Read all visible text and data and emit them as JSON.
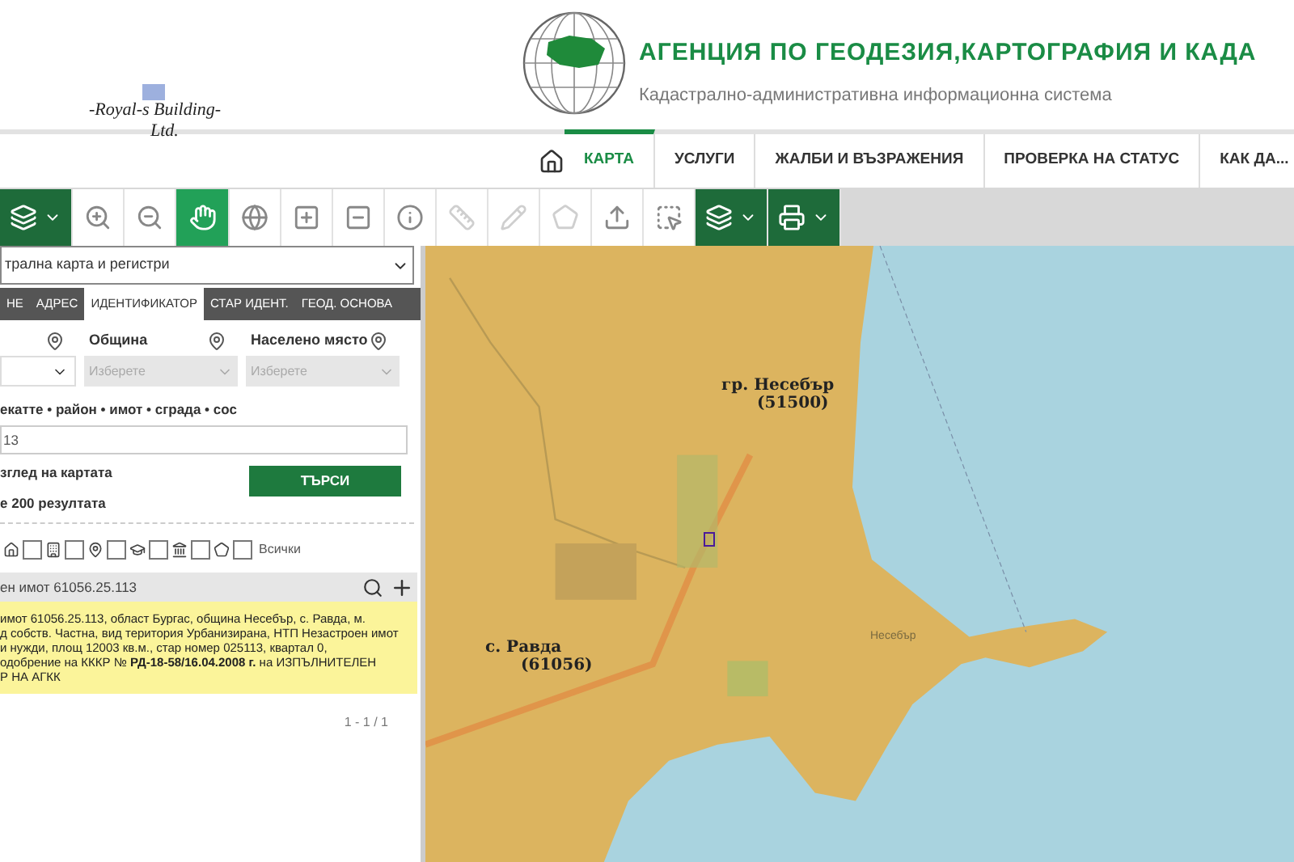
{
  "header": {
    "agency": "АГЕНЦИЯ ПО ГЕОДЕЗИЯ,КАРТОГРАФИЯ И КАДА",
    "subtitle": "Кадастрално-административна информационна система",
    "company_line_1": "-Royal-s Building-",
    "company_line_2": "Ltd."
  },
  "nav": [
    {
      "label": "КАРТА",
      "selected": true
    },
    {
      "label": "УСЛУГИ",
      "selected": false
    },
    {
      "label": "ЖАЛБИ И ВЪЗРАЖЕНИЯ",
      "selected": false
    },
    {
      "label": "ПРОВЕРКА НА СТАТУС",
      "selected": false
    },
    {
      "label": "КАК ДА...",
      "selected": false
    }
  ],
  "toolbar": [
    {
      "kind": "menu"
    },
    {
      "kind": "tool",
      "selected": false,
      "disabled": false
    },
    {
      "kind": "tool",
      "selected": false,
      "disabled": false
    },
    {
      "kind": "tool",
      "selected": true,
      "disabled": false
    },
    {
      "kind": "tool",
      "selected": false,
      "disabled": false
    },
    {
      "kind": "tool",
      "selected": false,
      "disabled": false
    },
    {
      "kind": "tool",
      "selected": false,
      "disabled": false
    },
    {
      "kind": "tool",
      "selected": false,
      "disabled": false
    },
    {
      "kind": "tool",
      "selected": false,
      "disabled": true
    },
    {
      "kind": "tool",
      "selected": false,
      "disabled": true
    },
    {
      "kind": "tool",
      "selected": false,
      "disabled": true
    },
    {
      "kind": "tool",
      "selected": false,
      "disabled": false
    },
    {
      "kind": "tool",
      "selected": false,
      "disabled": false
    },
    {
      "kind": "menu"
    },
    {
      "kind": "menu"
    }
  ],
  "panel": {
    "source_select": "трална карта и регистри",
    "tabs": [
      {
        "label": "НЕ",
        "selected": false
      },
      {
        "label": "АДРЕС",
        "selected": false
      },
      {
        "label": "ИДЕНТИФИКАТОР",
        "selected": true
      },
      {
        "label": "СТАР ИДЕНТ.",
        "selected": false
      },
      {
        "label": "ГЕОД. ОСНОВА",
        "selected": false
      }
    ],
    "fields": [
      {
        "label": "Община",
        "placeholder": "Изберете"
      },
      {
        "label": "Населено място",
        "placeholder": "Изберете"
      }
    ],
    "identifier_label": "екатте • район • имот • сграда • сос",
    "identifier_value": "13",
    "option_1": "зглед на картата",
    "option_2": "е 200 резултата",
    "search_button": "ТЪРСИ",
    "filters": [
      {
        "checked": false
      },
      {
        "checked": false
      },
      {
        "checked": false
      },
      {
        "checked": false
      },
      {
        "checked": false
      },
      {
        "checked": false
      }
    ],
    "all_label": "Всички",
    "result_title": "ен имот 61056.25.113",
    "result_lines": [
      "имот 61056.25.113, област Бургас, община Несебър, с. Равда, м.",
      "д собств. Частна, вид територия Урбанизирана, НТП Незастроен имот",
      "и нужди, площ 12003 кв.м., стар номер 025113, квартал 0,",
      "одобрение на КККР № **РД-18-58/16.04.2008 г.** на ИЗПЪЛНИТЕЛЕН",
      "Р НА АГКК"
    ],
    "pagination": "1 - 1 / 1"
  },
  "map": {
    "labels": [
      {
        "name": "гр. Несебър",
        "code": "(51500)"
      },
      {
        "name": "с. Равда",
        "code": "(61056)"
      }
    ],
    "town": "Несебър"
  }
}
